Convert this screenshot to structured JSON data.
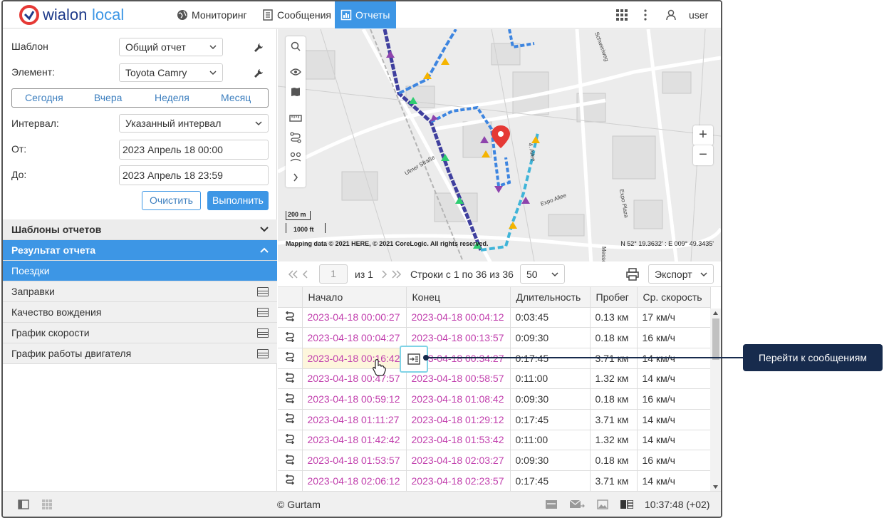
{
  "header": {
    "logo_text": "wialonlocal",
    "nav": [
      {
        "label": "Мониторинг",
        "icon": "globe-icon"
      },
      {
        "label": "Сообщения",
        "icon": "document-icon"
      },
      {
        "label": "Отчеты",
        "icon": "chart-icon"
      }
    ],
    "user_label": "user"
  },
  "form": {
    "template_label": "Шаблон",
    "template_value": "Общий отчет",
    "element_label": "Элемент:",
    "element_value": "Toyota Camry",
    "periods": [
      "Сегодня",
      "Вчера",
      "Неделя",
      "Месяц"
    ],
    "interval_label": "Интервал:",
    "interval_value": "Указанный интервал",
    "from_label": "От:",
    "from_value": "2023 Апрель 18 00:00",
    "to_label": "До:",
    "to_value": "2023 Апрель 18 23:59",
    "clear_label": "Очистить",
    "run_label": "Выполнить"
  },
  "sections": {
    "templates": "Шаблоны отчетов",
    "result": "Результат отчета",
    "items": [
      "Поездки",
      "Заправки",
      "Качество вождения",
      "График скорости",
      "График работы двигателя"
    ]
  },
  "map": {
    "scale_m": "200 m",
    "scale_ft": "1000 ft",
    "copyright": "Mapping data © 2021 HERE, © 2021 CoreLogic. All rights reserved.",
    "coords": "N 52° 19.3632' : E 009° 49.3435'",
    "streets": [
      "Ulmer Straße",
      "Expo Allee",
      "4. Allee",
      "Expo Plaza",
      "Schweriweg",
      "Messe"
    ]
  },
  "pager": {
    "page": "1",
    "of_label": "из 1",
    "rows_info": "Строки с 1 по 36 из 36",
    "page_size": "50",
    "export_label": "Экспорт"
  },
  "table": {
    "columns": [
      "Начало",
      "Конец",
      "Длительность",
      "Пробег",
      "Ср. скорость"
    ],
    "rows": [
      [
        "2023-04-18 00:00:27",
        "2023-04-18 00:04:12",
        "0:03:45",
        "0.13 км",
        "17 км/ч"
      ],
      [
        "2023-04-18 00:04:27",
        "2023-04-18 00:13:57",
        "0:09:30",
        "0.18 км",
        "16 км/ч"
      ],
      [
        "2023-04-18 00:16:42",
        "2023-04-18 00:34:27",
        "0:17:45",
        "3.71 км",
        "14 км/ч"
      ],
      [
        "2023-04-18 00:47:57",
        "2023-04-18 00:58:57",
        "0:11:00",
        "1.32 км",
        "14 км/ч"
      ],
      [
        "2023-04-18 00:59:12",
        "2023-04-18 01:08:42",
        "0:09:30",
        "0.18 км",
        "16 км/ч"
      ],
      [
        "2023-04-18 01:11:27",
        "2023-04-18 01:29:12",
        "0:17:45",
        "3.71 км",
        "14 км/ч"
      ],
      [
        "2023-04-18 01:42:42",
        "2023-04-18 01:53:42",
        "0:11:00",
        "1.32 км",
        "14 км/ч"
      ],
      [
        "2023-04-18 01:53:57",
        "2023-04-18 02:03:27",
        "0:09:30",
        "0.18 км",
        "16 км/ч"
      ],
      [
        "2023-04-18 02:06:12",
        "2023-04-18 02:23:57",
        "0:17:45",
        "3.71 км",
        "14 км/ч"
      ]
    ]
  },
  "footer": {
    "copyright": "© Gurtam",
    "time": "10:37:48 (+02)"
  },
  "tooltip": "Перейти к сообщениям",
  "colors": {
    "accent": "#3d96e5",
    "link": "#c13fad",
    "callout": "#172b4d"
  }
}
